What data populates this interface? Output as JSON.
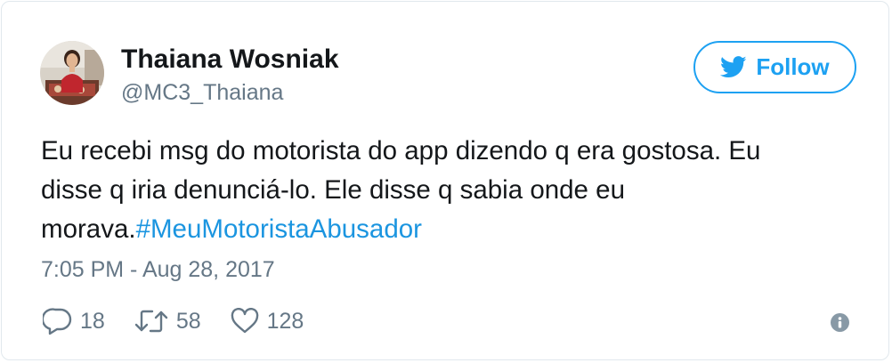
{
  "user": {
    "name": "Thaiana Wosniak",
    "handle": "@MC3_Thaiana"
  },
  "follow_button": {
    "label": "Follow",
    "icon": "twitter-bird-icon"
  },
  "tweet": {
    "line1": "Eu recebi msg do motorista do app dizendo q era gostosa. Eu",
    "line2": "disse q iria denunciá-lo. Ele disse q sabia onde eu",
    "line3_text": "morava.",
    "hashtag": "#MeuMotoristaAbusador",
    "timestamp": "7:05 PM - Aug 28, 2017"
  },
  "actions": {
    "replies": "18",
    "retweets": "58",
    "likes": "128"
  },
  "icons": {
    "reply": "reply-icon",
    "retweet": "retweet-icon",
    "like": "heart-icon",
    "info": "info-icon"
  },
  "colors": {
    "brand_blue": "#1da1f2",
    "hashtag_blue": "#1b95e0",
    "text_primary": "#14171a",
    "text_secondary": "#657786"
  }
}
